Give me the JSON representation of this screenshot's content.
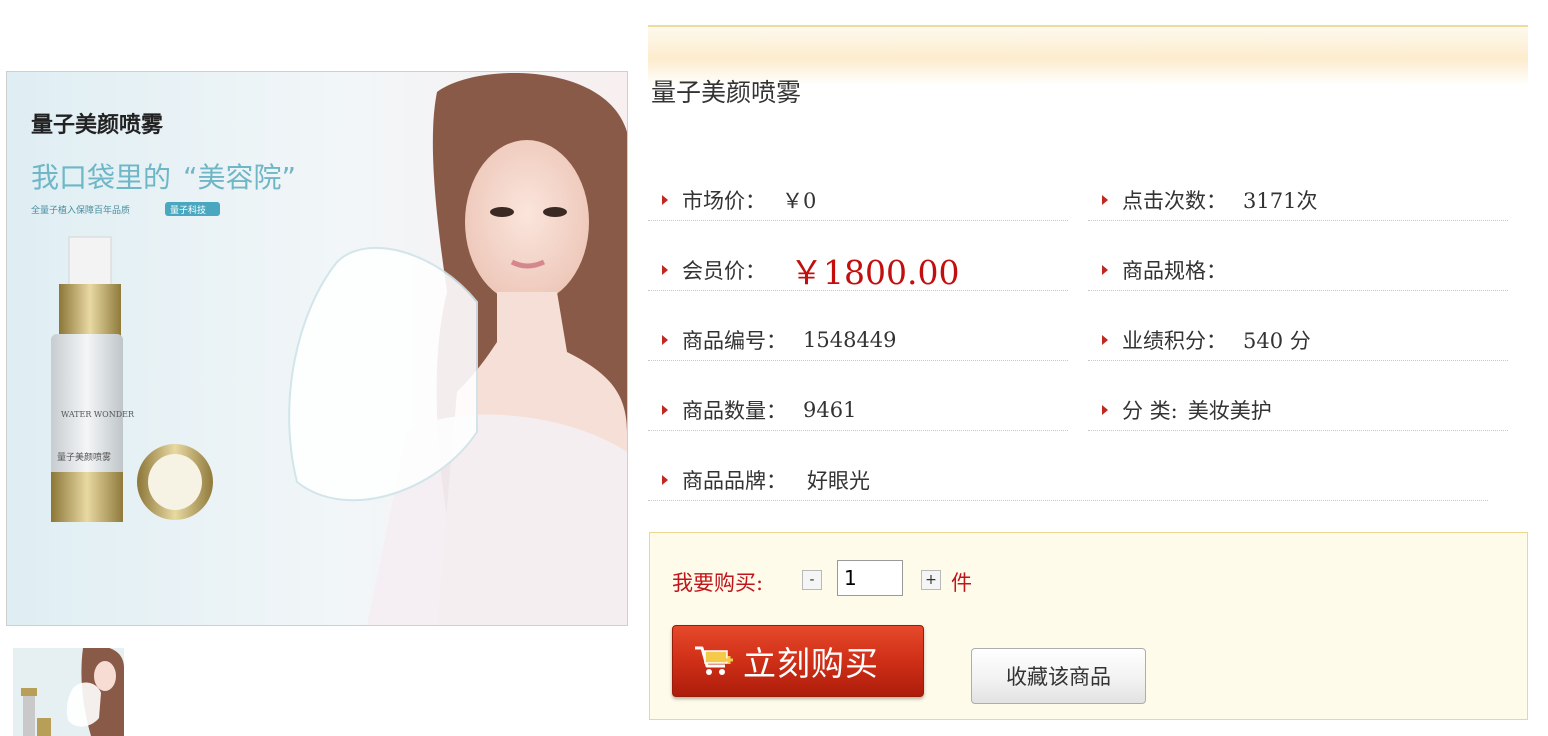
{
  "image": {
    "heading": "量子美颜喷雾",
    "slogan_part1": "我口袋里的",
    "slogan_part2": "“美容院”",
    "tagline": "全量子植入保障百年品质",
    "badge": "量子科技",
    "bottle_text": "WATER WONDER",
    "bottle_text_cn": "量子美颜喷雾"
  },
  "product": {
    "title": "量子美颜喷雾"
  },
  "attributes": {
    "market_price_label": "市场价：",
    "market_price_value": "￥0",
    "clicks_label": "点击次数：",
    "clicks_value": "3171次",
    "member_price_label": "会员价：",
    "member_price_value": "￥1800.00",
    "spec_label": "商品规格：",
    "spec_value": "",
    "code_label": "商品编号：",
    "code_value": "1548449",
    "points_label": "业绩积分：",
    "points_value": "540 分",
    "quantity_label": "商品数量：",
    "quantity_value": "9461",
    "category_label": "分 类:",
    "category_value": "美妆美护",
    "brand_label": "商品品牌：",
    "brand_value": "好眼光"
  },
  "purchase": {
    "label": "我要购买:",
    "minus": "-",
    "plus": "+",
    "quantity": "1",
    "unit": "件",
    "buy_now": "立刻购买",
    "favorite": "收藏该商品"
  },
  "colors": {
    "accent_red": "#c20e0e",
    "buy_button": "#cf2f17",
    "buy_box_border": "#ead790",
    "buy_box_bg": "#fffbea"
  }
}
